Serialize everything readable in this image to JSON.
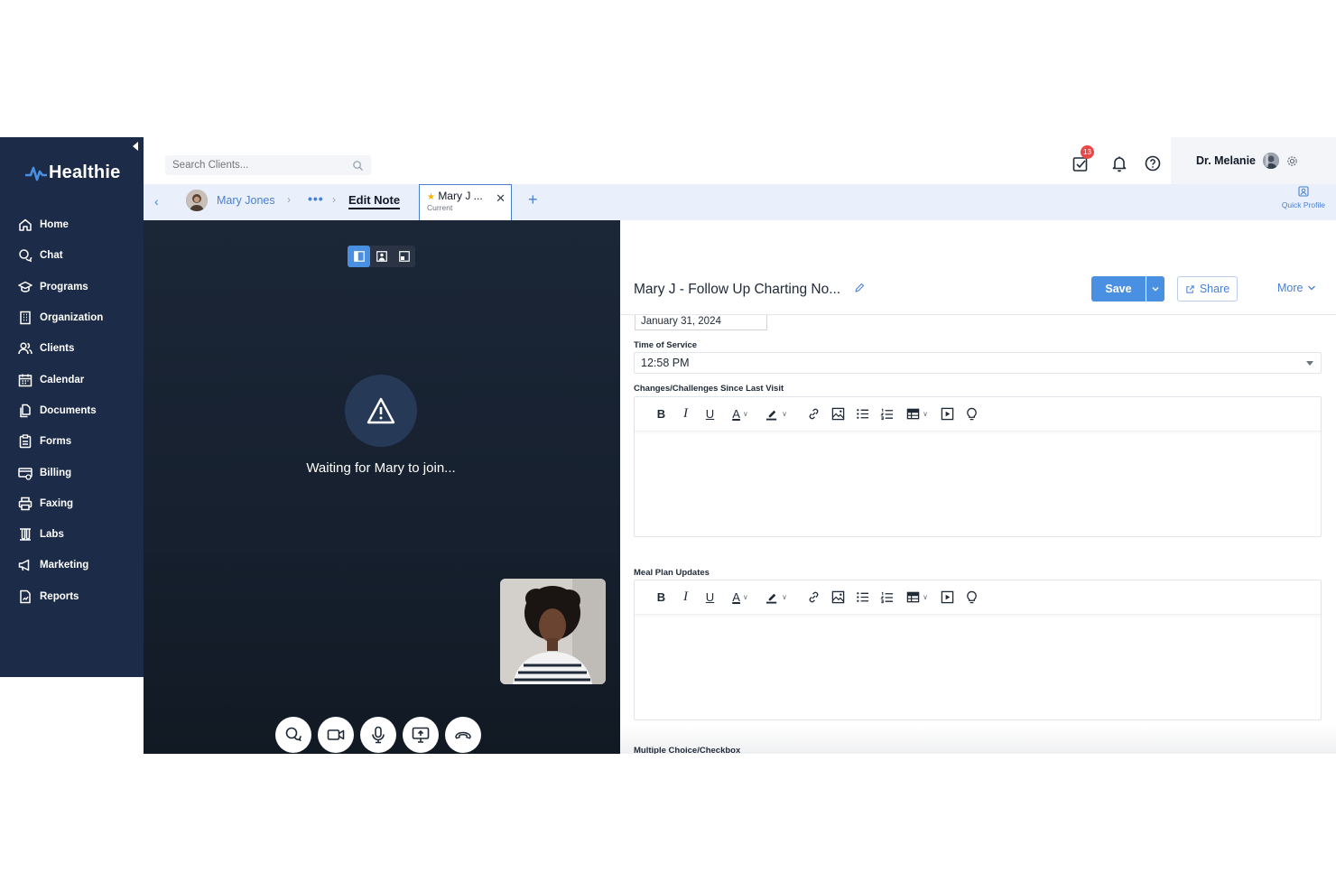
{
  "brand": {
    "name": "Healthie"
  },
  "sidebar": {
    "items": [
      {
        "label": "Home",
        "icon": "home-icon"
      },
      {
        "label": "Chat",
        "icon": "chat-icon"
      },
      {
        "label": "Programs",
        "icon": "programs-icon"
      },
      {
        "label": "Organization",
        "icon": "organization-icon"
      },
      {
        "label": "Clients",
        "icon": "clients-icon"
      },
      {
        "label": "Calendar",
        "icon": "calendar-icon"
      },
      {
        "label": "Documents",
        "icon": "documents-icon"
      },
      {
        "label": "Forms",
        "icon": "forms-icon"
      },
      {
        "label": "Billing",
        "icon": "billing-icon"
      },
      {
        "label": "Faxing",
        "icon": "fax-icon"
      },
      {
        "label": "Labs",
        "icon": "labs-icon"
      },
      {
        "label": "Marketing",
        "icon": "marketing-icon"
      },
      {
        "label": "Reports",
        "icon": "reports-icon"
      }
    ]
  },
  "topbar": {
    "search_placeholder": "Search Clients...",
    "tasks_badge": "13",
    "user_name": "Dr. Melanie"
  },
  "tabs": {
    "client_name": "Mary Jones",
    "more": "•••",
    "edit_note": "Edit Note",
    "current_tab_title": "Mary J ...",
    "current_tab_sub": "Current",
    "quick_profile": "Quick Profile"
  },
  "video": {
    "waiting_text": "Waiting for Mary to join..."
  },
  "note": {
    "title": "Mary J - Follow Up Charting No...",
    "save_label": "Save",
    "share_label": "Share",
    "more_label": "More",
    "date_value": "January 31, 2024",
    "time_label": "Time of Service",
    "time_value": "12:58 PM",
    "changes_label": "Changes/Challenges Since Last Visit",
    "meal_label": "Meal Plan Updates",
    "cutoff_label": "Multiple Choice/Checkbox"
  },
  "colors": {
    "sidebar_bg": "#1c2b47",
    "accent": "#4a90e2",
    "tabbar_bg": "#e9f0fb",
    "badge": "#e74848"
  }
}
